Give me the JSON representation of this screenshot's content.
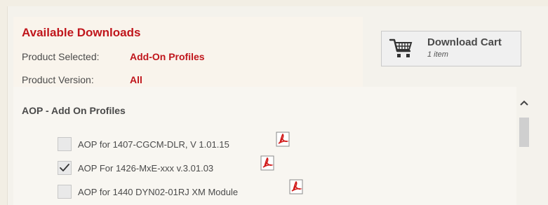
{
  "downloads": {
    "title": "Available Downloads",
    "product_selected_label": "Product Selected:",
    "product_selected_value": "Add-On Profiles",
    "product_version_label": "Product Version:",
    "product_version_value": "All"
  },
  "cart": {
    "title": "Download Cart",
    "count": "1 item",
    "icon": "shopping-cart-icon"
  },
  "section": {
    "title": "AOP - Add On Profiles",
    "items": [
      {
        "label": "AOP for 1407-CGCM-DLR, V 1.01.15",
        "checked": false,
        "icon": "pdf-icon"
      },
      {
        "label": "AOP For 1426-MxE-xxx v.3.01.03",
        "checked": true,
        "icon": "pdf-icon"
      },
      {
        "label": "AOP for 1440 DYN02-01RJ XM Module",
        "checked": false,
        "icon": "pdf-icon"
      }
    ]
  },
  "colors": {
    "accent": "#c0161c",
    "text": "#4a4a4a",
    "panel_bg": "#f4f2ec"
  }
}
